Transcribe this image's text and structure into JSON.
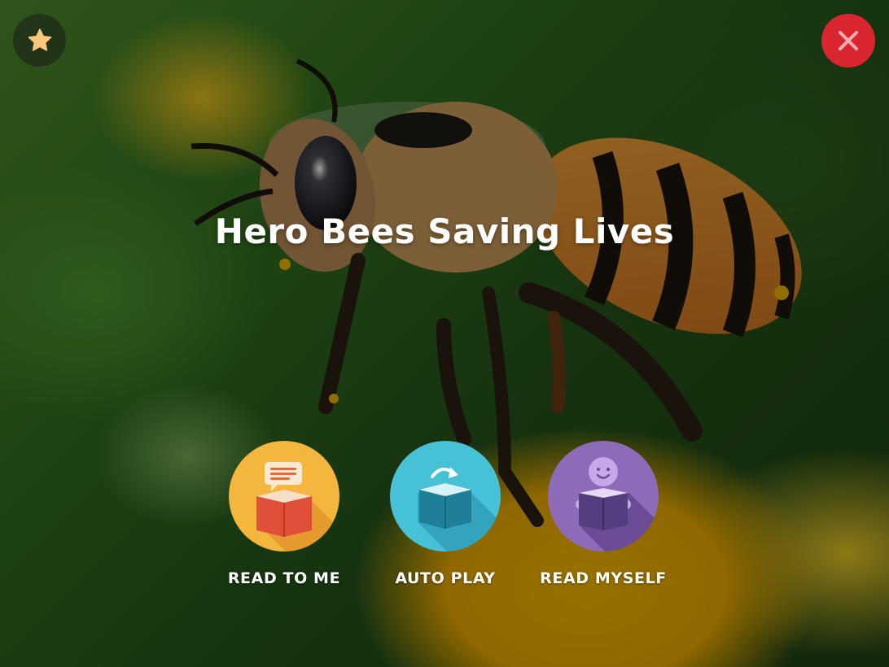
{
  "story": {
    "title": "Hero Bees Saving Lives"
  },
  "toolbar": {
    "favorite_icon": "star-icon",
    "close_icon": "close-icon"
  },
  "modes": [
    {
      "label": "READ TO ME",
      "icon": "book-with-speech-bubble-icon",
      "color": "#f4b63c"
    },
    {
      "label": "AUTO PLAY",
      "icon": "book-with-arrow-icon",
      "color": "#46c1d6"
    },
    {
      "label": "READ MYSELF",
      "icon": "child-reading-icon",
      "color": "#8d6bb8"
    }
  ],
  "colors": {
    "close": "#d9262f",
    "star": "#f7c77d"
  }
}
